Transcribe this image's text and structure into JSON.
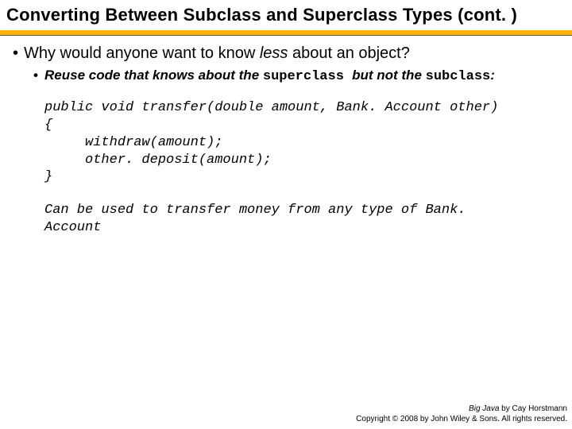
{
  "title": "Converting Between Subclass and Superclass Types  (cont. )",
  "bullets": {
    "level1": {
      "pre": "Why would anyone want to know ",
      "em": "less",
      "post": " about an object?"
    },
    "level2": {
      "pre": "Reuse code that knows about the ",
      "mono1": "superclass ",
      "mid": "but not the ",
      "mono2": "subclass",
      "post": ":"
    }
  },
  "code": "public void transfer(double amount, Bank. Account other)\n{\n     withdraw(amount);\n     other. deposit(amount);\n}",
  "note": "Can be used to transfer money from any type of Bank. Account",
  "footer": {
    "book": "Big Java",
    "author": " by Cay Horstmann",
    "copyright": "Copyright © 2008 by John Wiley & Sons. All rights reserved."
  }
}
